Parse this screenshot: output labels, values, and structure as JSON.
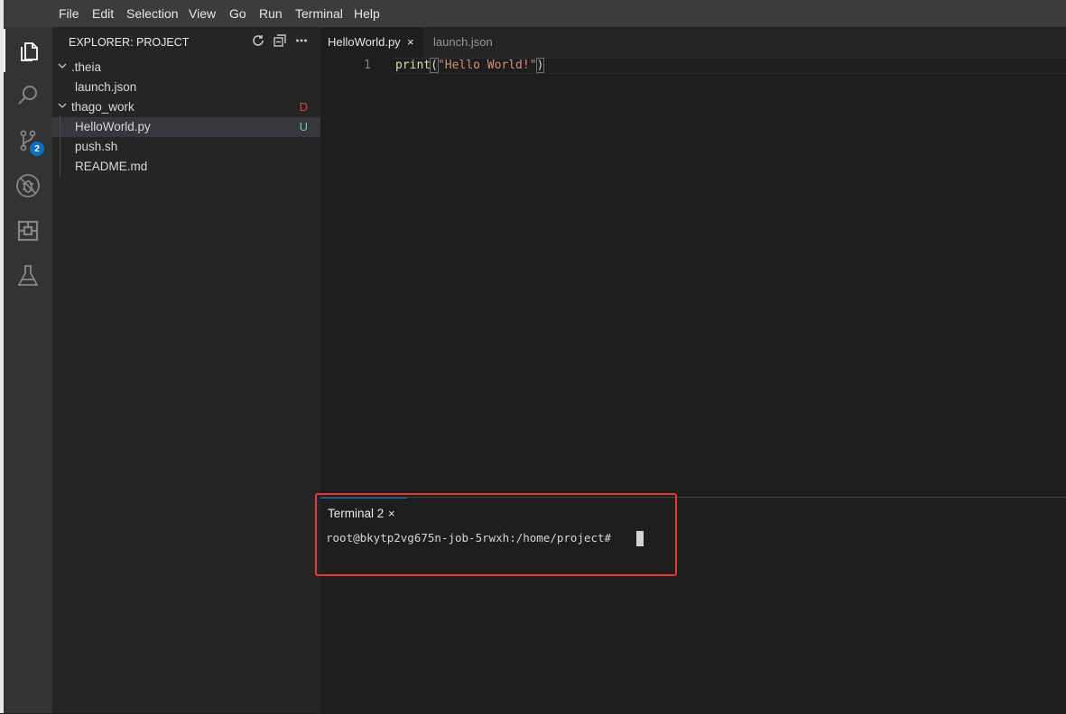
{
  "menu": [
    "File",
    "Edit",
    "Selection",
    "View",
    "Go",
    "Run",
    "Terminal",
    "Help"
  ],
  "activity": {
    "icons": [
      "explorer-icon",
      "search-icon",
      "source-control-icon",
      "debug-icon",
      "extensions-icon",
      "test-flask-icon"
    ],
    "source_control_badge": "2",
    "badge_color": "#0e70c0"
  },
  "explorer": {
    "title": "EXPLORER: PROJECT",
    "actions": [
      "refresh-icon",
      "collapse-all-icon",
      "more-icon"
    ],
    "tree": [
      {
        "label": ".theia",
        "type": "folder",
        "status": ""
      },
      {
        "label": "launch.json",
        "type": "file",
        "status": ""
      },
      {
        "label": "thago_work",
        "type": "folder",
        "status": "D"
      },
      {
        "label": "HelloWorld.py",
        "type": "file",
        "status": "U"
      },
      {
        "label": "push.sh",
        "type": "file",
        "status": ""
      },
      {
        "label": "README.md",
        "type": "file",
        "status": ""
      }
    ],
    "status_colors": {
      "D": "#c74e39",
      "U": "#73c991"
    }
  },
  "editor": {
    "tabs": [
      {
        "label": "HelloWorld.py",
        "active": true,
        "close": "×"
      },
      {
        "label": "launch.json",
        "active": false,
        "close": ""
      }
    ],
    "line_number": "1",
    "code": {
      "fn": "print",
      "open": "(",
      "str": "\"Hello World!\"",
      "close": ")"
    }
  },
  "terminal": {
    "tab_label": "Terminal 2",
    "tab_close": "×",
    "prompt": "root@bkytp2vg675n-job-5rwxh:/home/project#"
  }
}
